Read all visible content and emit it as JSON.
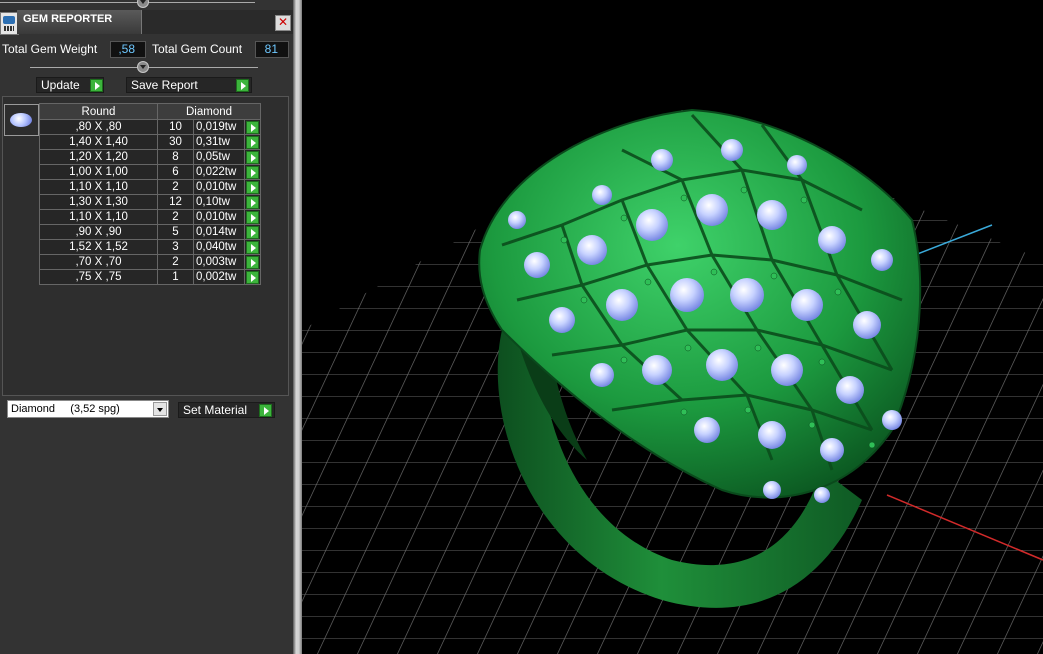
{
  "window": {
    "title": "GEM REPORTER"
  },
  "summary": {
    "total_weight_label": "Total Gem Weight",
    "total_weight_value": ",58",
    "total_count_label": "Total Gem Count",
    "total_count_value": "81"
  },
  "buttons": {
    "update": "Update",
    "save_report": "Save Report",
    "set_material": "Set Material"
  },
  "table": {
    "headers": [
      "Round",
      "Diamond"
    ],
    "rows": [
      {
        "size": ",80 X ,80",
        "count": "10",
        "weight": "0,019tw"
      },
      {
        "size": "1,40 X 1,40",
        "count": "30",
        "weight": "0,31tw"
      },
      {
        "size": "1,20 X 1,20",
        "count": "8",
        "weight": "0,05tw"
      },
      {
        "size": "1,00 X 1,00",
        "count": "6",
        "weight": "0,022tw"
      },
      {
        "size": "1,10 X 1,10",
        "count": "2",
        "weight": "0,010tw"
      },
      {
        "size": "1,30 X 1,30",
        "count": "12",
        "weight": "0,10tw"
      },
      {
        "size": "1,10 X 1,10",
        "count": "2",
        "weight": "0,010tw"
      },
      {
        "size": ",90 X ,90",
        "count": "5",
        "weight": "0,014tw"
      },
      {
        "size": "1,52 X 1,52",
        "count": "3",
        "weight": "0,040tw"
      },
      {
        "size": ",70 X ,70",
        "count": "2",
        "weight": "0,003tw"
      },
      {
        "size": ",75 X ,75",
        "count": "1",
        "weight": "0,002tw"
      }
    ]
  },
  "material": {
    "selected": "Diamond     (3,52 spg)"
  },
  "colors": {
    "accent_green": "#3cb43c",
    "value_text": "#6ec8ff",
    "panel_bg": "#333333",
    "model_green": "#1f8f3a",
    "gem_blue": "#b9c8ff"
  },
  "icons": [
    "gem-reporter-app-icon",
    "close-icon",
    "play-arrow-icon",
    "round-diamond-icon",
    "dropdown-arrow-icon"
  ]
}
